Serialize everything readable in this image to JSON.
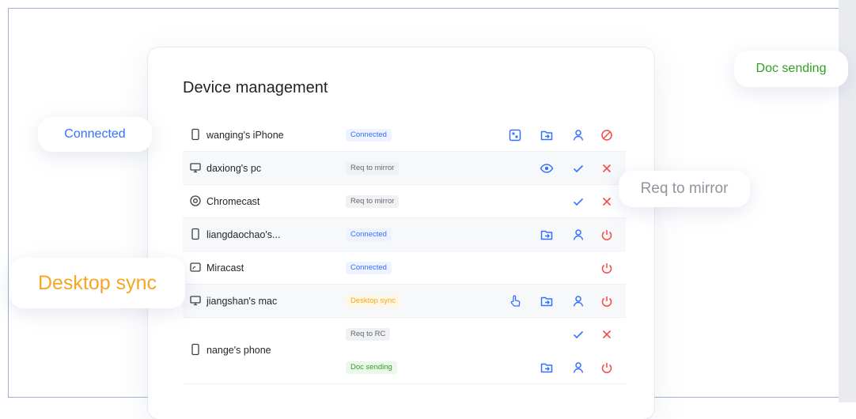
{
  "title": "Device management",
  "bubbles": {
    "connected": "Connected",
    "doc_sending": "Doc sending",
    "req_mirror": "Req to mirror",
    "desktop_sync": "Desktop sync"
  },
  "devices": [
    {
      "name": "wanging's iPhone",
      "icon": "phone-icon",
      "status": "Connected",
      "actions": [
        "share-screen-icon",
        "file-send-icon",
        "user-icon",
        "disconnect-icon"
      ]
    },
    {
      "name": "daxiong's pc",
      "icon": "monitor-icon",
      "status": "Req to mirror",
      "actions": [
        "eye-icon",
        "check-icon",
        "close-icon"
      ]
    },
    {
      "name": "Chromecast",
      "icon": "chromecast-icon",
      "status": "Req to mirror",
      "actions": [
        "check-icon",
        "close-icon"
      ]
    },
    {
      "name": "liangdaochao's...",
      "icon": "phone-icon",
      "status": "Connected",
      "actions": [
        "file-send-icon",
        "user-icon",
        "power-icon"
      ]
    },
    {
      "name": "Miracast",
      "icon": "miracast-icon",
      "status": "Connected",
      "actions": [
        "power-icon"
      ]
    },
    {
      "name": "jiangshan's mac",
      "icon": "monitor-icon",
      "status": "Desktop sync",
      "actions": [
        "touch-icon",
        "file-send-icon",
        "user-icon",
        "power-icon"
      ]
    },
    {
      "name": "nange's phone",
      "icon": "phone-icon",
      "statuses": [
        {
          "status": "Req to RC",
          "actions": [
            "check-icon",
            "close-icon"
          ]
        },
        {
          "status": "Doc sending",
          "actions": [
            "file-send-icon",
            "user-icon",
            "power-icon"
          ]
        }
      ]
    }
  ]
}
